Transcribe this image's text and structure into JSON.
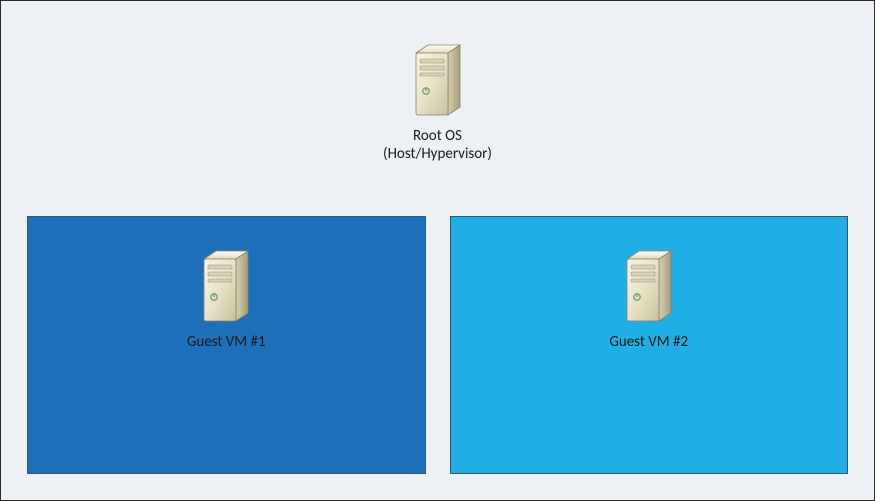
{
  "root": {
    "label_line1": "Root OS",
    "label_line2": "(Host/Hypervisor)"
  },
  "vms": [
    {
      "label": "Guest VM #1",
      "bg": "#1e70bb"
    },
    {
      "label": "Guest VM #2",
      "bg": "#21aee4"
    }
  ],
  "colors": {
    "canvas_bg": "#edf0f5",
    "canvas_border": "#2a2a2a",
    "vm_border": "#2b587f"
  }
}
